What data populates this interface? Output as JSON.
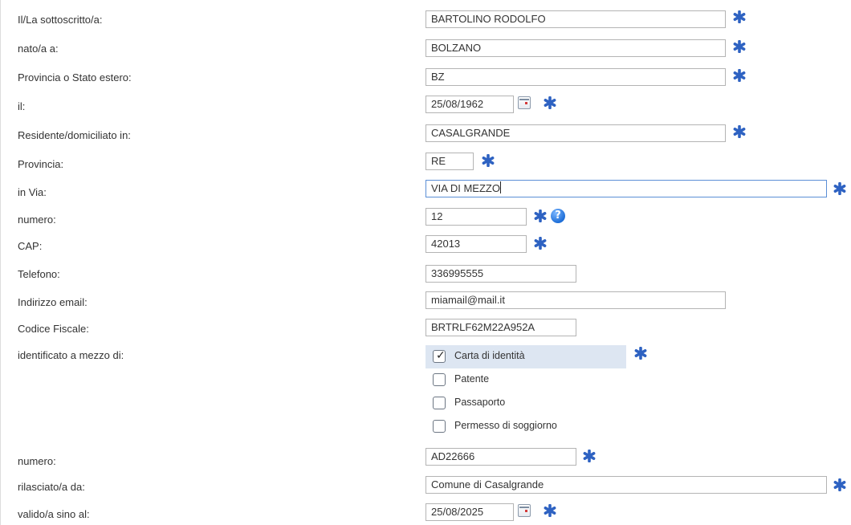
{
  "form": {
    "rows": [
      {
        "label": "Il/La sottoscritto/a:",
        "value": "BARTOLINO RODOLFO",
        "required": true
      },
      {
        "label": "nato/a a:",
        "value": "BOLZANO",
        "required": true
      },
      {
        "label": "Provincia o Stato estero:",
        "value": "BZ",
        "required": true
      },
      {
        "label": "il:",
        "value": "25/08/1962",
        "required": true
      },
      {
        "label": "Residente/domiciliato in:",
        "value": "CASALGRANDE",
        "required": true
      },
      {
        "label": "Provincia:",
        "value": "RE",
        "required": true
      },
      {
        "label": "in Via:",
        "value": "VIA DI MEZZO",
        "required": true
      },
      {
        "label": "numero:",
        "value": "12",
        "required": true
      },
      {
        "label": "CAP:",
        "value": "42013",
        "required": true
      },
      {
        "label": "Telefono:",
        "value": "336995555",
        "required": false
      },
      {
        "label": "Indirizzo email:",
        "value": "miamail@mail.it",
        "required": false
      },
      {
        "label": "Codice Fiscale:",
        "value": "BRTRLF62M22A952A",
        "required": false
      }
    ],
    "identification": {
      "label": "identificato a mezzo di:",
      "required": true,
      "options": [
        {
          "label": "Carta di identità",
          "checked": true
        },
        {
          "label": "Patente",
          "checked": false
        },
        {
          "label": "Passaporto",
          "checked": false
        },
        {
          "label": "Permesso di soggiorno",
          "checked": false
        }
      ]
    },
    "document": [
      {
        "label": "numero:",
        "value": "AD22666",
        "required": true
      },
      {
        "label": "rilasciato/a da:",
        "value": "Comune di Casalgrande",
        "required": true
      },
      {
        "label": "valido/a sino al:",
        "value": "25/08/2025",
        "required": true
      }
    ]
  },
  "colors": {
    "required_star": "#2e62c2",
    "selected_row": "#dde6f2",
    "input_border": "#b4b4b4",
    "focus_border": "#5b8fd6"
  },
  "icons": {
    "required": "asterisk-icon",
    "calendar": "calendar-icon",
    "help": "help-icon"
  }
}
